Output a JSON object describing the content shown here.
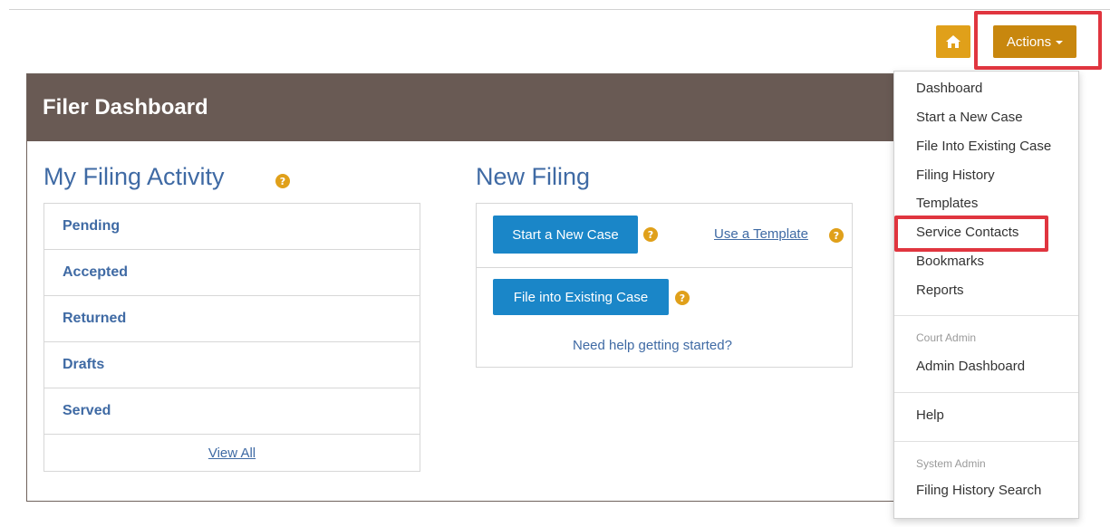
{
  "toolbar": {
    "home_icon": "home-icon",
    "actions_label": "Actions",
    "accent": "#e0a01a",
    "actions_color": "#c8870e"
  },
  "header": {
    "title": "Filer Dashboard",
    "color": "#695a54"
  },
  "activity": {
    "title": "My Filing Activity",
    "items": [
      {
        "label": "Pending"
      },
      {
        "label": "Accepted"
      },
      {
        "label": "Returned"
      },
      {
        "label": "Drafts"
      },
      {
        "label": "Served"
      }
    ],
    "view_all": "View All"
  },
  "new_filing": {
    "title": "New Filing",
    "start_new_case": "Start a New Case",
    "use_template": "Use a Template",
    "file_existing": "File into Existing Case",
    "need_help": "Need help getting started?",
    "button_color": "#1a86c8"
  },
  "menu": {
    "items": [
      "Dashboard",
      "Start a New Case",
      "File Into Existing Case",
      "Filing History",
      "Templates",
      "Service Contacts",
      "Bookmarks",
      "Reports"
    ],
    "court_admin_header": "Court Admin",
    "admin_dashboard": "Admin Dashboard",
    "help": "Help",
    "system_admin_header": "System Admin",
    "filing_history_search": "Filing History Search"
  },
  "highlight_color": "#e0353f"
}
